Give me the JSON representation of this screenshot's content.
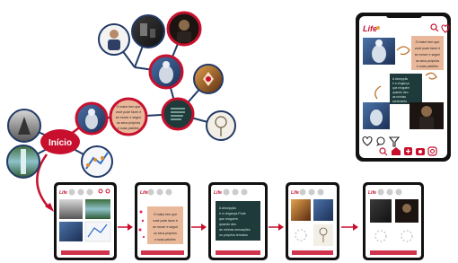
{
  "mindmap": {
    "center_label": "Início",
    "quote_short": [
      "O maior tem que",
      "você pode fazer é",
      "se mover e seguir",
      "os seus próprios",
      "e suas paixões"
    ],
    "colors": {
      "red": "#c8102e",
      "edge_dark": "#223a66",
      "edge_red": "#c8102e",
      "quote_bg": "#e9b89a"
    }
  },
  "big_phone": {
    "logo": "Life",
    "quote_lines": [
      "O maior tem que",
      "você pode fazer é",
      "se mover e seguir",
      "os seus próprios",
      "e suas paixões"
    ],
    "note_lines": [
      "A decepção",
      "é a vingança",
      "que ninguém",
      "quando deu",
      "as minhas",
      "sentimento"
    ],
    "top_icons": [
      "search-icon",
      "heart-icon"
    ],
    "action_icons": [
      "heart-outline-icon",
      "comment-icon",
      "filter-icon"
    ],
    "nav_icons": [
      "search-icon",
      "home-icon",
      "add-icon",
      "camera-icon",
      "instagram-icon"
    ]
  },
  "flow": {
    "small_logo": "Life",
    "quote_lines": [
      "O maior tem que",
      "você pode fazer é",
      "se mover e seguir",
      "os seus próprios",
      "e suas paixões"
    ],
    "note_lines": [
      "A decepção",
      "é a vingança Pode",
      "que ninguém",
      "quando deu",
      "as minhas sensações",
      "os próprios ternatos"
    ]
  }
}
